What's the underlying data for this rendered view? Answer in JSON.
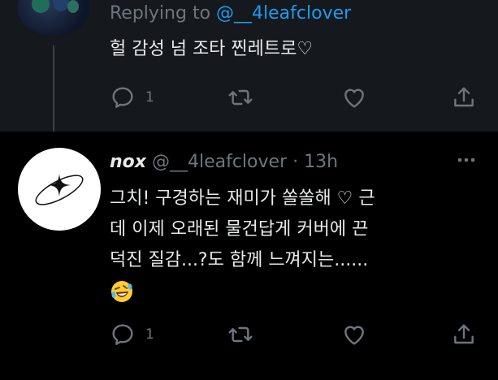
{
  "reply_tweet": {
    "replying_prefix": "Replying to",
    "replying_handle": "@__4leafclover",
    "text": "헐 감성 넘 조타 찐레트로♡",
    "reply_count": "1"
  },
  "main_tweet": {
    "display_name": "nox",
    "handle": "@__4leafclover",
    "separator": " · ",
    "time": "13h",
    "lines": [
      "그치! 구경하는 재미가 쏠쏠해 ♡ 근",
      "데 이제 오래된 물건답게 커버에 끈",
      "덕진 질감...?도 함께 느껴지는......"
    ],
    "emoji": "rolling-on-floor-laughing-emoji",
    "reply_count": "1"
  },
  "icons": {
    "reply": "reply-icon",
    "retweet": "retweet-icon",
    "like": "heart-icon",
    "share": "share-icon",
    "more": "more-icon"
  },
  "colors": {
    "background_top": "#15181c",
    "background_bottom": "#000000",
    "text": "#e7e9ea",
    "muted": "#6e767d",
    "link": "#1d9bf0"
  }
}
